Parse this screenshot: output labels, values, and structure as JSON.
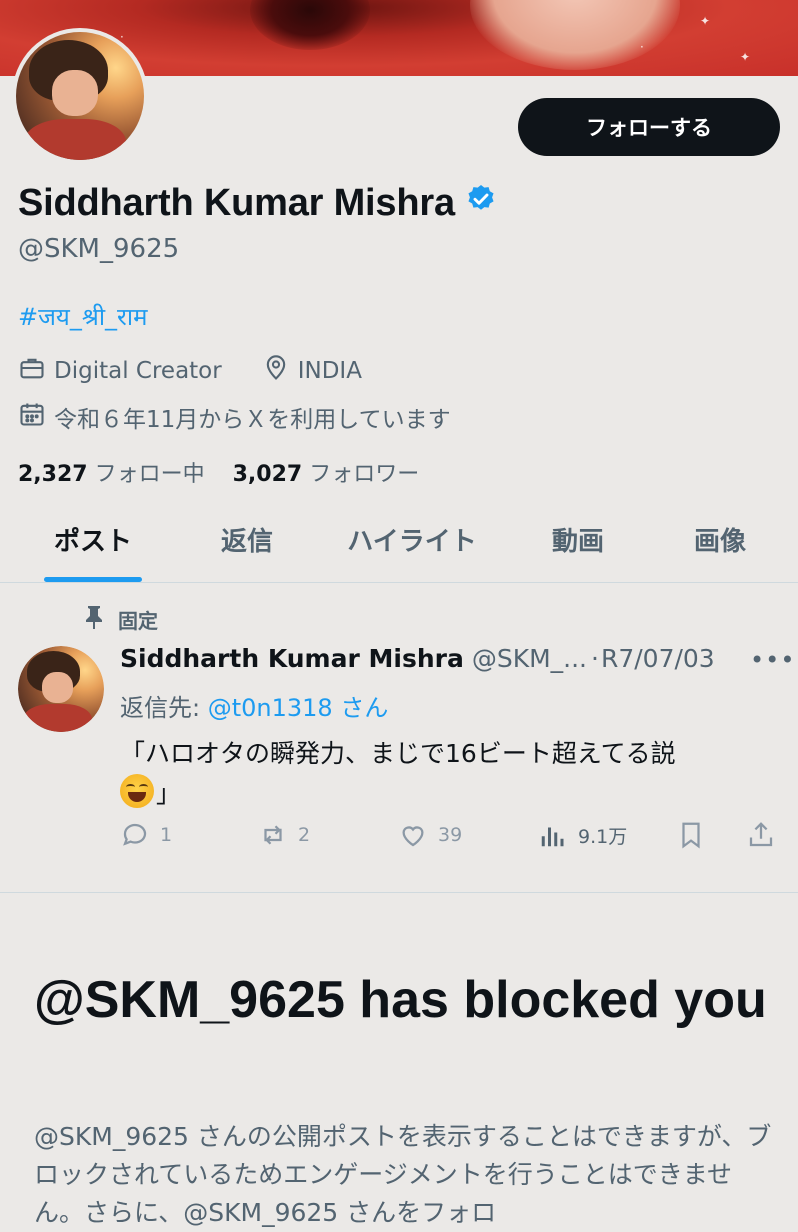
{
  "profile": {
    "follow_button": "フォローする",
    "name": "Siddharth Kumar Mishra",
    "handle": "@SKM_9625",
    "bio": "#जय_श्री_राम",
    "category": "Digital Creator",
    "location": "INDIA",
    "joined": "令和６年11月からＸを利用しています",
    "following_count": "2,327",
    "following_label": "フォロー中",
    "followers_count": "3,027",
    "followers_label": "フォロワー"
  },
  "tabs": [
    {
      "label": "ポスト",
      "active": true
    },
    {
      "label": "返信",
      "active": false
    },
    {
      "label": "ハイライト",
      "active": false
    },
    {
      "label": "動画",
      "active": false
    },
    {
      "label": "画像",
      "active": false
    }
  ],
  "pinned_post": {
    "pinned_label": "固定",
    "author_name": "Siddharth Kumar Mishra",
    "author_handle": "@SKM_...",
    "separator": "·",
    "date": "R7/07/03",
    "reply_prefix": "返信先: ",
    "reply_handle": "@t0n1318",
    "reply_suffix": " さん",
    "text_line1": "「ハロオタの瞬発力、まじで16ビート超えてる説",
    "text_line2_suffix": "」",
    "emoji_icon": "face-with-tears-of-joy-icon",
    "replies": "1",
    "reposts": "2",
    "likes": "39",
    "views": "9.1万"
  },
  "blocked_notice": {
    "title": "@SKM_9625 has blocked you",
    "body": "@SKM_9625 さんの公開ポストを表示することはできますが、ブロックされているためエンゲージメントを行うことはできません。さらに、@SKM_9625 さんをフォロ"
  },
  "colors": {
    "accent": "#1d9bf0",
    "text_primary": "#0f1419",
    "text_secondary": "#536471",
    "background": "#ebe9e7"
  }
}
